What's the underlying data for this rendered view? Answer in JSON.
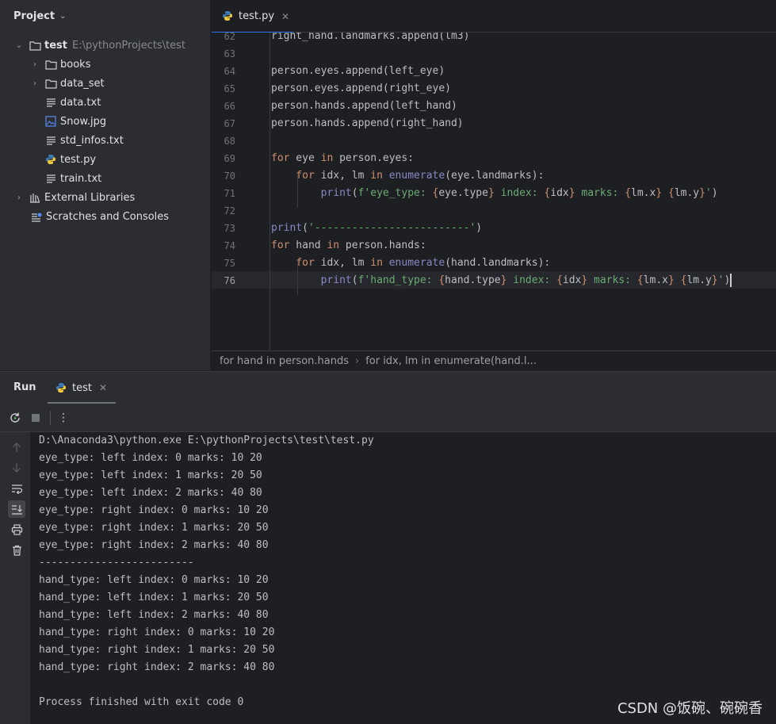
{
  "project": {
    "header": "Project",
    "root_name": "test",
    "root_path": "E:\\pythonProjects\\test",
    "items": [
      {
        "label": "books"
      },
      {
        "label": "data_set"
      },
      {
        "label": "data.txt"
      },
      {
        "label": "Snow.jpg"
      },
      {
        "label": "std_infos.txt"
      },
      {
        "label": "test.py"
      },
      {
        "label": "train.txt"
      },
      {
        "label": "External Libraries"
      },
      {
        "label": "Scratches and Consoles"
      }
    ]
  },
  "editor": {
    "tab_label": "test.py",
    "line_numbers": [
      "62",
      "63",
      "64",
      "65",
      "66",
      "67",
      "68",
      "69",
      "70",
      "71",
      "72",
      "73",
      "74",
      "75",
      "76"
    ],
    "current_line": "76",
    "code": {
      "l62": "right_hand.landmarks.append(lm3)",
      "l64": "person.eyes.append(left_eye)",
      "l65": "person.eyes.append(right_eye)",
      "l66": "person.hands.append(left_hand)",
      "l67": "person.hands.append(right_hand)",
      "l69_kw": "for",
      "l69_a": " eye ",
      "l69_in": "in",
      "l69_b": " person.eyes:",
      "l70_kw": "for",
      "l70_a": " idx, lm ",
      "l70_in": "in",
      "l70_fn": "enumerate",
      "l70_b": "(eye.landmarks):",
      "l71_fn": "print",
      "l71_o": "(",
      "l71_s1": "f'eye_type: ",
      "l71_p1": "eye.type",
      "l71_s2": " index: ",
      "l71_p2": "idx",
      "l71_s3": " marks: ",
      "l71_p3": "lm.x",
      "l71_p4": "lm.y",
      "l71_s4": "'",
      "l71_c": ")",
      "l73_fn": "print",
      "l73_s": "'-------------------------'",
      "l74_kw": "for",
      "l74_a": " hand ",
      "l74_in": "in",
      "l74_b": " person.hands:",
      "l75_kw": "for",
      "l75_a": " idx, lm ",
      "l75_in": "in",
      "l75_fn": "enumerate",
      "l75_b": "(hand.landmarks):",
      "l76_fn": "print",
      "l76_s1": "f'hand_type: ",
      "l76_p1": "hand.type",
      "l76_s2": " index: ",
      "l76_p2": "idx",
      "l76_s3": " marks: ",
      "l76_p3": "lm.x",
      "l76_p4": "lm.y",
      "l76_s4": "'"
    },
    "breadcrumb": [
      "for hand in person.hands",
      "for idx, lm in enumerate(hand.l..."
    ]
  },
  "run": {
    "title": "Run",
    "tab_label": "test",
    "console": [
      "D:\\Anaconda3\\python.exe E:\\pythonProjects\\test\\test.py",
      "eye_type: left index: 0 marks: 10 20",
      "eye_type: left index: 1 marks: 20 50",
      "eye_type: left index: 2 marks: 40 80",
      "eye_type: right index: 0 marks: 10 20",
      "eye_type: right index: 1 marks: 20 50",
      "eye_type: right index: 2 marks: 40 80",
      "-------------------------",
      "hand_type: left index: 0 marks: 10 20",
      "hand_type: left index: 1 marks: 20 50",
      "hand_type: left index: 2 marks: 40 80",
      "hand_type: right index: 0 marks: 10 20",
      "hand_type: right index: 1 marks: 20 50",
      "hand_type: right index: 2 marks: 40 80",
      "",
      "Process finished with exit code 0"
    ]
  },
  "watermark": "CSDN @饭碗、碗碗香"
}
